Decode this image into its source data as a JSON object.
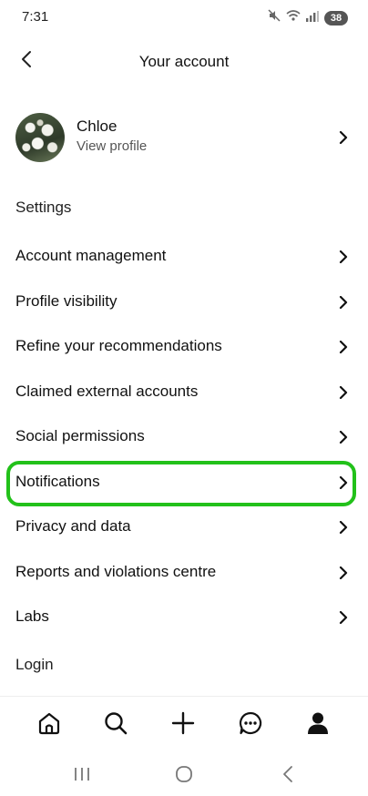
{
  "status": {
    "time": "7:31",
    "battery": "38",
    "icons": [
      "mute-icon",
      "wifi-icon",
      "signal-icon",
      "battery-icon"
    ]
  },
  "header": {
    "title": "Your account",
    "back_icon": "back-chevron-icon"
  },
  "profile": {
    "name": "Chloe",
    "subtitle": "View profile"
  },
  "settings_heading": "Settings",
  "menu": {
    "items": [
      {
        "label": "Account management"
      },
      {
        "label": "Profile visibility"
      },
      {
        "label": "Refine your recommendations"
      },
      {
        "label": "Claimed external accounts"
      },
      {
        "label": "Social permissions"
      },
      {
        "label": "Notifications",
        "highlighted": true
      },
      {
        "label": "Privacy and data"
      },
      {
        "label": "Reports and violations centre"
      },
      {
        "label": "Labs"
      }
    ]
  },
  "login_heading": "Login",
  "bottom_nav": [
    "home-icon",
    "search-icon",
    "create-plus-icon",
    "messages-icon",
    "profile-icon"
  ],
  "system_nav": [
    "recents-icon",
    "home-circle-icon",
    "back-icon"
  ],
  "colors": {
    "highlight": "#22c11a",
    "text": "#111111",
    "muted": "#555555"
  }
}
